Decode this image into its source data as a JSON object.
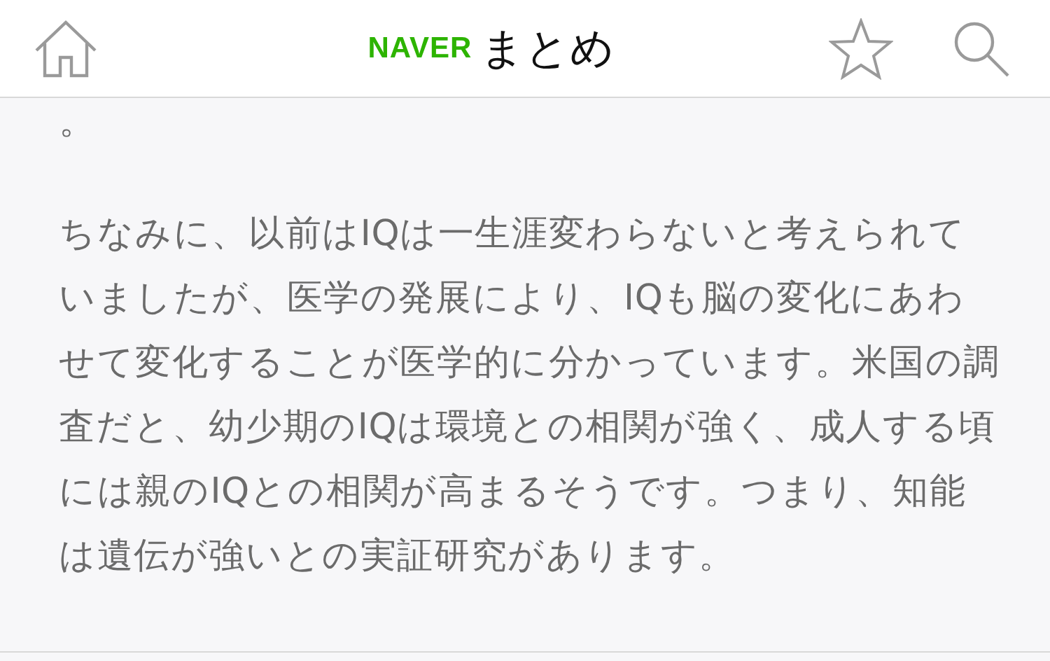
{
  "header": {
    "brand": "NAVER",
    "title": "まとめ"
  },
  "article": {
    "fragment": "。",
    "paragraph": "ちなみに、以前はIQは一生涯変わらないと考えられていましたが、医学の発展により、IQも脳の変化にあわせて変化することが医学的に分かっています。米国の調査だと、幼少期のIQは環境との相関が強く、成人する頃には親のIQとの相関が高まるそうです。つまり、知能は遺伝が強いとの実証研究があります。"
  }
}
